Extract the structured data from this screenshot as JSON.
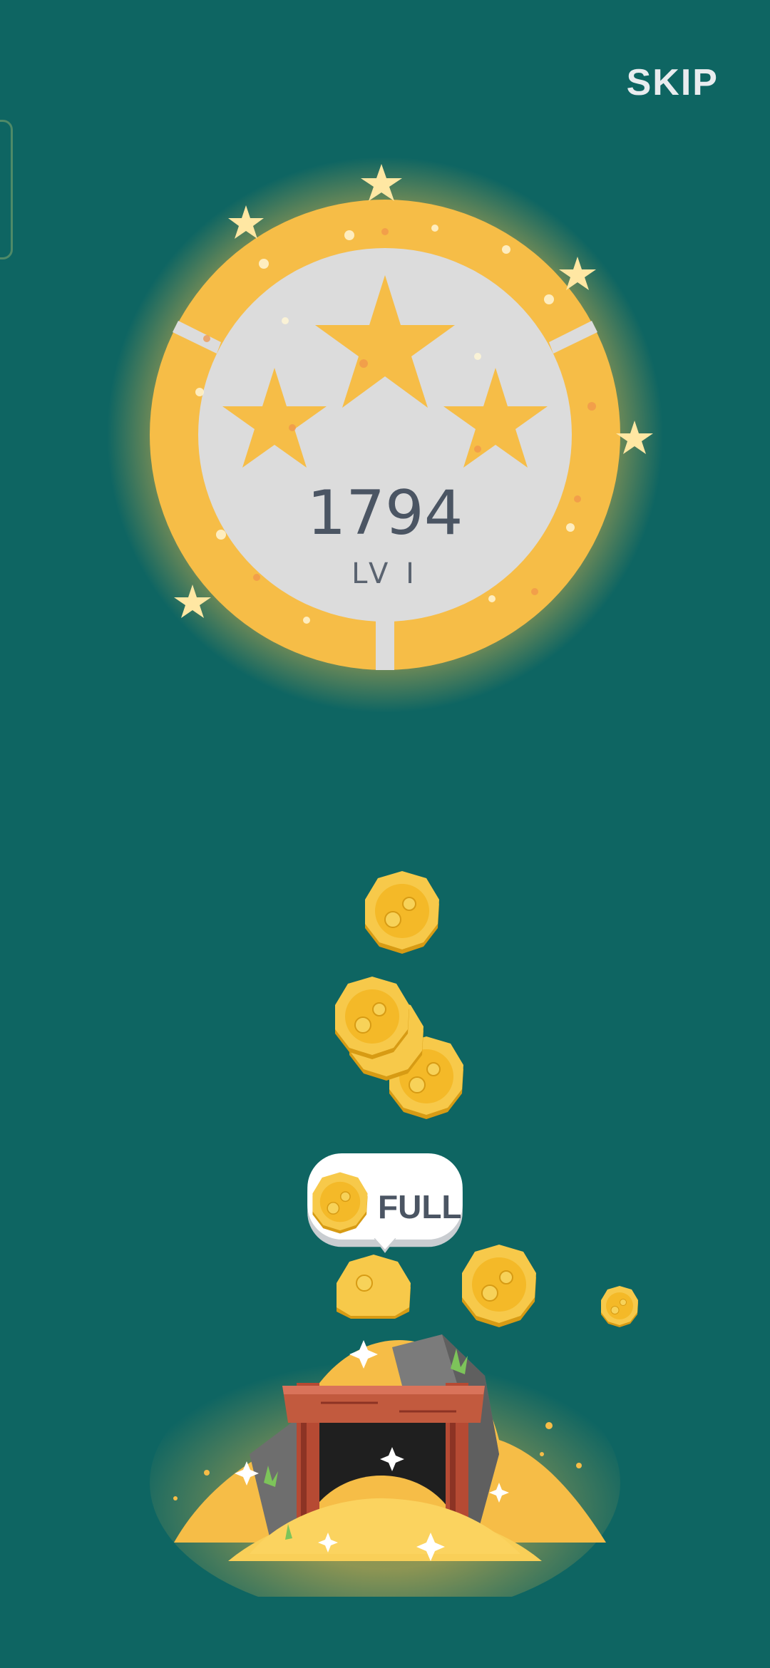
{
  "header": {
    "skip_label": "SKIP"
  },
  "badge": {
    "score": "1794",
    "level": "LV I",
    "stars_filled": 3,
    "stars_total": 3
  },
  "mine": {
    "status_label": "FULL"
  },
  "colors": {
    "background": "#0e6562",
    "gold": "#f6bd47",
    "plate": "#dcdcdc"
  }
}
